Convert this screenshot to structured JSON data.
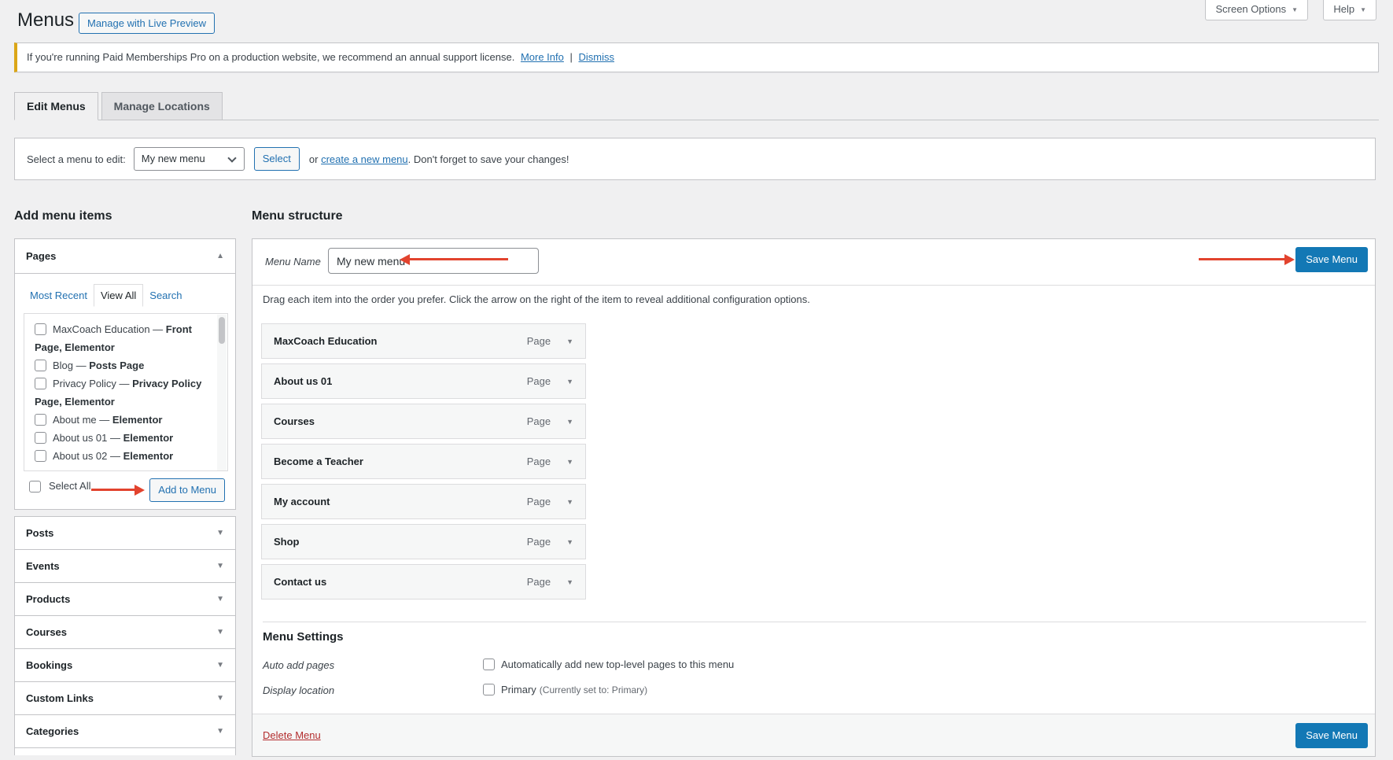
{
  "colors": {
    "accent_blue": "#1378b5",
    "link_blue": "#2271b1",
    "notice_yellow": "#dba617",
    "annotation_red": "#e2432e",
    "delete_red": "#b32d2e"
  },
  "page": {
    "title": "Menus",
    "live_preview_button": "Manage with Live Preview",
    "screen_options_label": "Screen Options",
    "help_label": "Help"
  },
  "notice": {
    "text": "If you're running Paid Memberships Pro on a production website, we recommend an annual support license.",
    "more_info_link": "More Info",
    "separator": "|",
    "dismiss_link": "Dismiss"
  },
  "tabs": {
    "edit_menus": "Edit Menus",
    "manage_locations": "Manage Locations"
  },
  "menu_select_bar": {
    "label": "Select a menu to edit:",
    "selected_menu": "My new menu",
    "select_button": "Select",
    "or_text": "or",
    "create_link": "create a new menu",
    "suffix_text": ". Don't forget to save your changes!"
  },
  "add_menu_items": {
    "heading": "Add menu items",
    "pages_panel": {
      "title": "Pages",
      "tabs": {
        "most_recent": "Most Recent",
        "view_all": "View All",
        "search": "Search"
      },
      "items": [
        {
          "text": "MaxCoach Education — ",
          "bold": "Front Page, Elementor"
        },
        {
          "text": "Blog — ",
          "bold": "Posts Page"
        },
        {
          "text": "Privacy Policy — ",
          "bold": "Privacy Policy Page, Elementor"
        },
        {
          "text": "About me — ",
          "bold": "Elementor"
        },
        {
          "text": "About us 01 — ",
          "bold": "Elementor"
        },
        {
          "text": "About us 02 — ",
          "bold": "Elementor"
        }
      ],
      "select_all_label": "Select All",
      "add_to_menu_button": "Add to Menu"
    },
    "accordions": [
      {
        "label": "Posts"
      },
      {
        "label": "Events"
      },
      {
        "label": "Products"
      },
      {
        "label": "Courses"
      },
      {
        "label": "Bookings"
      },
      {
        "label": "Custom Links"
      },
      {
        "label": "Categories"
      }
    ]
  },
  "menu_structure": {
    "heading": "Menu structure",
    "name_label": "Menu Name",
    "name_value": "My new menu",
    "save_button": "Save Menu",
    "instruction": "Drag each item into the order you prefer. Click the arrow on the right of the item to reveal additional configuration options.",
    "items": [
      {
        "label": "MaxCoach Education",
        "type": "Page"
      },
      {
        "label": "About us 01",
        "type": "Page"
      },
      {
        "label": "Courses",
        "type": "Page"
      },
      {
        "label": "Become a Teacher",
        "type": "Page"
      },
      {
        "label": "My account",
        "type": "Page"
      },
      {
        "label": "Shop",
        "type": "Page"
      },
      {
        "label": "Contact us",
        "type": "Page"
      }
    ]
  },
  "menu_settings": {
    "heading": "Menu Settings",
    "auto_add_label": "Auto add pages",
    "auto_add_option": "Automatically add new top-level pages to this menu",
    "display_location_label": "Display location",
    "display_location_option": "Primary",
    "display_location_note": "(Currently set to: Primary)"
  },
  "footer_bar": {
    "delete_link": "Delete Menu",
    "save_button": "Save Menu"
  }
}
